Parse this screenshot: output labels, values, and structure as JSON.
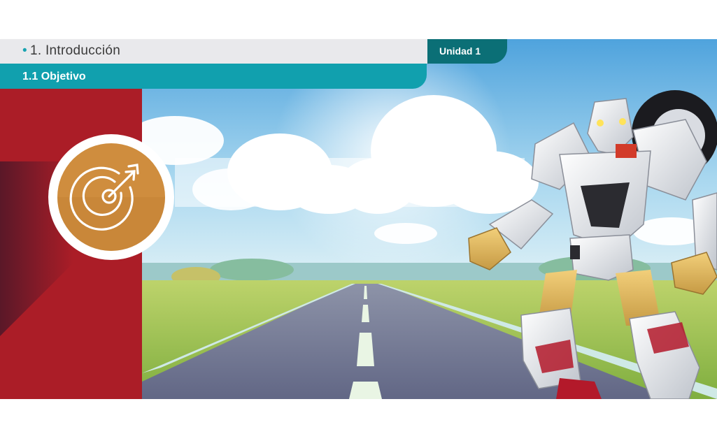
{
  "header": {
    "title": "1. Introducción",
    "unit_label": "Unidad 1"
  },
  "subheader": {
    "label": "1.1 Objetivo"
  },
  "icons": {
    "objective": "target-arrow-icon"
  },
  "colors": {
    "header_bg": "#e9e9ec",
    "unit_tab": "#0b6f76",
    "subheader_bg": "#11a0ae",
    "side_panel": "#b21f29",
    "badge": "#cf8d3e"
  }
}
